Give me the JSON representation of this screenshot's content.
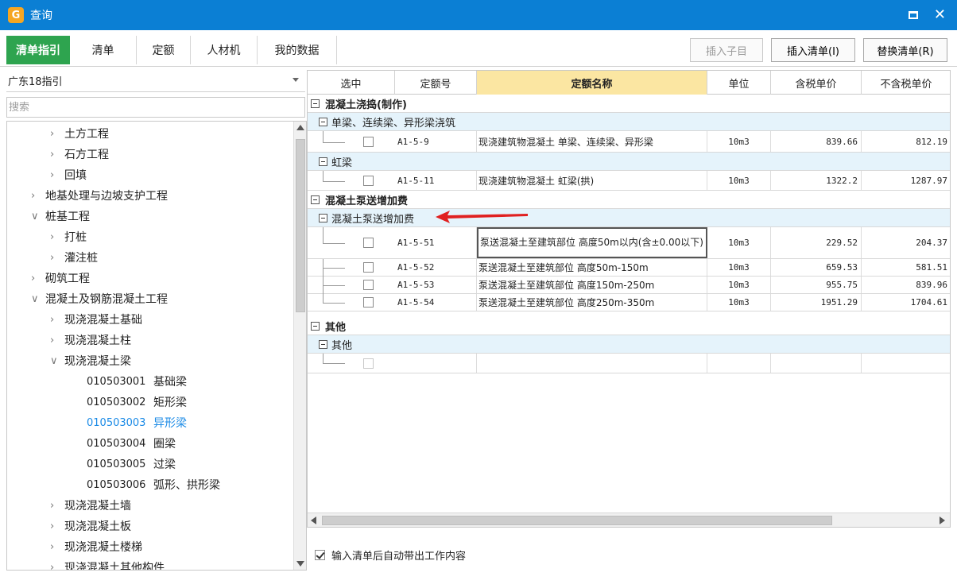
{
  "window": {
    "title": "查询",
    "accent": "#0b7fd4"
  },
  "tabs": [
    {
      "label": "清单指引",
      "active": true
    },
    {
      "label": "清单"
    },
    {
      "label": "定额"
    },
    {
      "label": "人材机"
    },
    {
      "label": "我的数据"
    }
  ],
  "toolbar": {
    "insert_child": "插入子目",
    "insert_list": "插入清单(I)",
    "replace_list": "替换清单(R)"
  },
  "left": {
    "combo_value": "广东18指引",
    "search_placeholder": "搜索",
    "tree": [
      {
        "label": "土方工程",
        "level": 1,
        "state": "collapsed"
      },
      {
        "label": "石方工程",
        "level": 1,
        "state": "collapsed"
      },
      {
        "label": "回填",
        "level": 1,
        "state": "collapsed"
      },
      {
        "label": "地基处理与边坡支护工程",
        "level": 0,
        "state": "collapsed"
      },
      {
        "label": "桩基工程",
        "level": 0,
        "state": "expanded"
      },
      {
        "label": "打桩",
        "level": 1,
        "state": "collapsed"
      },
      {
        "label": "灌注桩",
        "level": 1,
        "state": "collapsed"
      },
      {
        "label": "砌筑工程",
        "level": 0,
        "state": "collapsed"
      },
      {
        "label": "混凝土及钢筋混凝土工程",
        "level": 0,
        "state": "expanded"
      },
      {
        "label": "现浇混凝土基础",
        "level": 1,
        "state": "collapsed"
      },
      {
        "label": "现浇混凝土柱",
        "level": 1,
        "state": "collapsed"
      },
      {
        "label": "现浇混凝土梁",
        "level": 1,
        "state": "expanded"
      },
      {
        "code": "010503001",
        "label": "基础梁",
        "level": 2
      },
      {
        "code": "010503002",
        "label": "矩形梁",
        "level": 2
      },
      {
        "code": "010503003",
        "label": "异形梁",
        "level": 2,
        "selected": true
      },
      {
        "code": "010503004",
        "label": "圈梁",
        "level": 2
      },
      {
        "code": "010503005",
        "label": "过梁",
        "level": 2
      },
      {
        "code": "010503006",
        "label": "弧形、拱形梁",
        "level": 2
      },
      {
        "label": "现浇混凝土墙",
        "level": 1,
        "state": "collapsed"
      },
      {
        "label": "现浇混凝土板",
        "level": 1,
        "state": "collapsed"
      },
      {
        "label": "现浇混凝土楼梯",
        "level": 1,
        "state": "collapsed"
      },
      {
        "label": "现浇混凝土其他构件",
        "level": 1,
        "state": "collapsed"
      }
    ]
  },
  "grid": {
    "headers": [
      "选中",
      "定额号",
      "定额名称",
      "单位",
      "含税单价",
      "不含税单价"
    ],
    "groups": {
      "g1": "混凝土浇捣(制作)",
      "g1s1": "单梁、连续梁、异形梁浇筑",
      "g1s2": "虹梁",
      "g2": "混凝土泵送增加费",
      "g2s1": "混凝土泵送增加费",
      "g3": "其他",
      "g3s1": "其他"
    },
    "rows": [
      {
        "code": "A1-5-9",
        "name": "现浇建筑物混凝土 单梁、连续梁、异形梁",
        "unit": "10m3",
        "tax_price": "839.66",
        "notax_price": "812.19"
      },
      {
        "code": "A1-5-11",
        "name": "现浇建筑物混凝土 虹梁(拱)",
        "unit": "10m3",
        "tax_price": "1322.2",
        "notax_price": "1287.97"
      },
      {
        "code": "A1-5-51",
        "name": "泵送混凝土至建筑部位 高度50m以内(含±0.00以下)",
        "unit": "10m3",
        "tax_price": "229.52",
        "notax_price": "204.37"
      },
      {
        "code": "A1-5-52",
        "name": "泵送混凝土至建筑部位 高度50m-150m",
        "unit": "10m3",
        "tax_price": "659.53",
        "notax_price": "581.51"
      },
      {
        "code": "A1-5-53",
        "name": "泵送混凝土至建筑部位 高度150m-250m",
        "unit": "10m3",
        "tax_price": "955.75",
        "notax_price": "839.96"
      },
      {
        "code": "A1-5-54",
        "name": "泵送混凝土至建筑部位 高度250m-350m",
        "unit": "10m3",
        "tax_price": "1951.29",
        "notax_price": "1704.61"
      }
    ]
  },
  "footer": {
    "auto_content": "输入清单后自动带出工作内容"
  }
}
